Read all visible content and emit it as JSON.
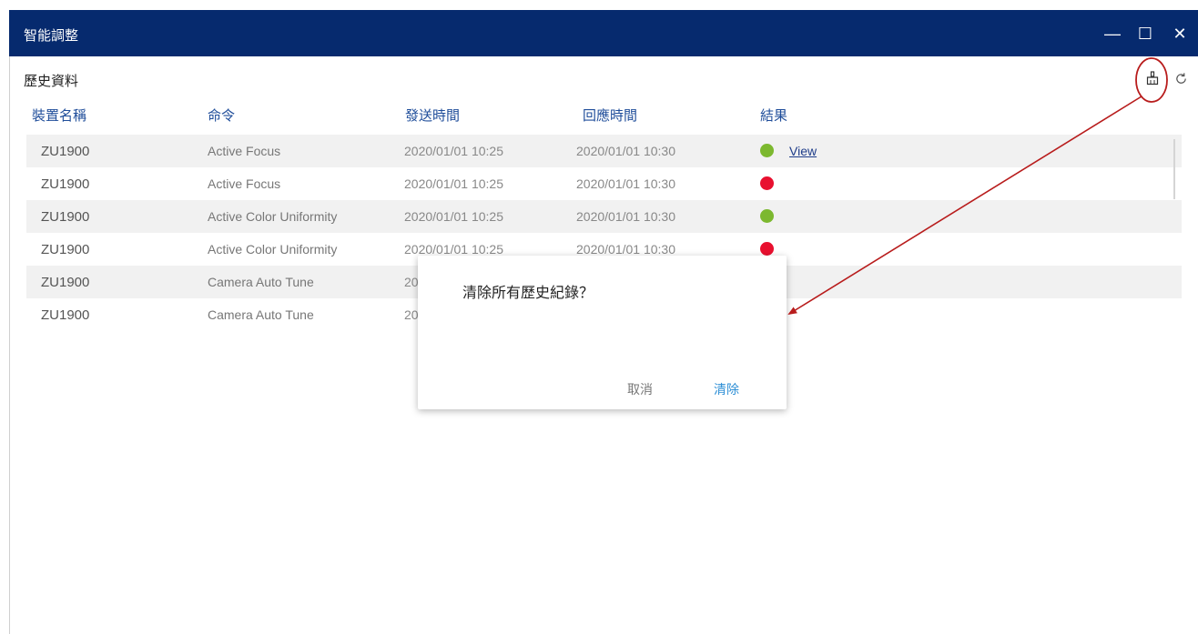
{
  "window": {
    "title": "智能調整",
    "minimize_glyph": "—",
    "maximize_glyph": "☐",
    "close_glyph": "✕"
  },
  "section": {
    "title": "歷史資料",
    "clear_icon": "clear-broom-icon",
    "refresh_icon": "refresh-icon"
  },
  "table": {
    "headers": [
      "裝置名稱",
      "命令",
      "發送時間",
      "回應時間",
      "結果"
    ],
    "rows": [
      {
        "device": "ZU1900",
        "command": "Active Focus",
        "send": "2020/01/01 10:25",
        "response": "2020/01/01 10:30",
        "result": "success",
        "link": "View"
      },
      {
        "device": "ZU1900",
        "command": "Active Focus",
        "send": "2020/01/01 10:25",
        "response": "2020/01/01 10:30",
        "result": "fail"
      },
      {
        "device": "ZU1900",
        "command": "Active Color Uniformity",
        "send": "2020/01/01 10:25",
        "response": "2020/01/01 10:30",
        "result": "success"
      },
      {
        "device": "ZU1900",
        "command": "Active Color Uniformity",
        "send": "2020/01/01 10:25",
        "response": "2020/01/01 10:30",
        "result": "fail"
      },
      {
        "device": "ZU1900",
        "command": "Camera Auto Tune",
        "send": "20",
        "response": "",
        "result": ""
      },
      {
        "device": "ZU1900",
        "command": "Camera Auto Tune",
        "send": "20",
        "response": "",
        "result": ""
      }
    ]
  },
  "dialog": {
    "message": "清除所有歷史紀錄？",
    "cancel_label": "取消",
    "confirm_label": "清除"
  },
  "colors": {
    "titlebar": "#062a6e",
    "success": "#7cb82f",
    "fail": "#e8102f",
    "annotation": "#b81c1c",
    "header_text": "#1f4d9a"
  }
}
